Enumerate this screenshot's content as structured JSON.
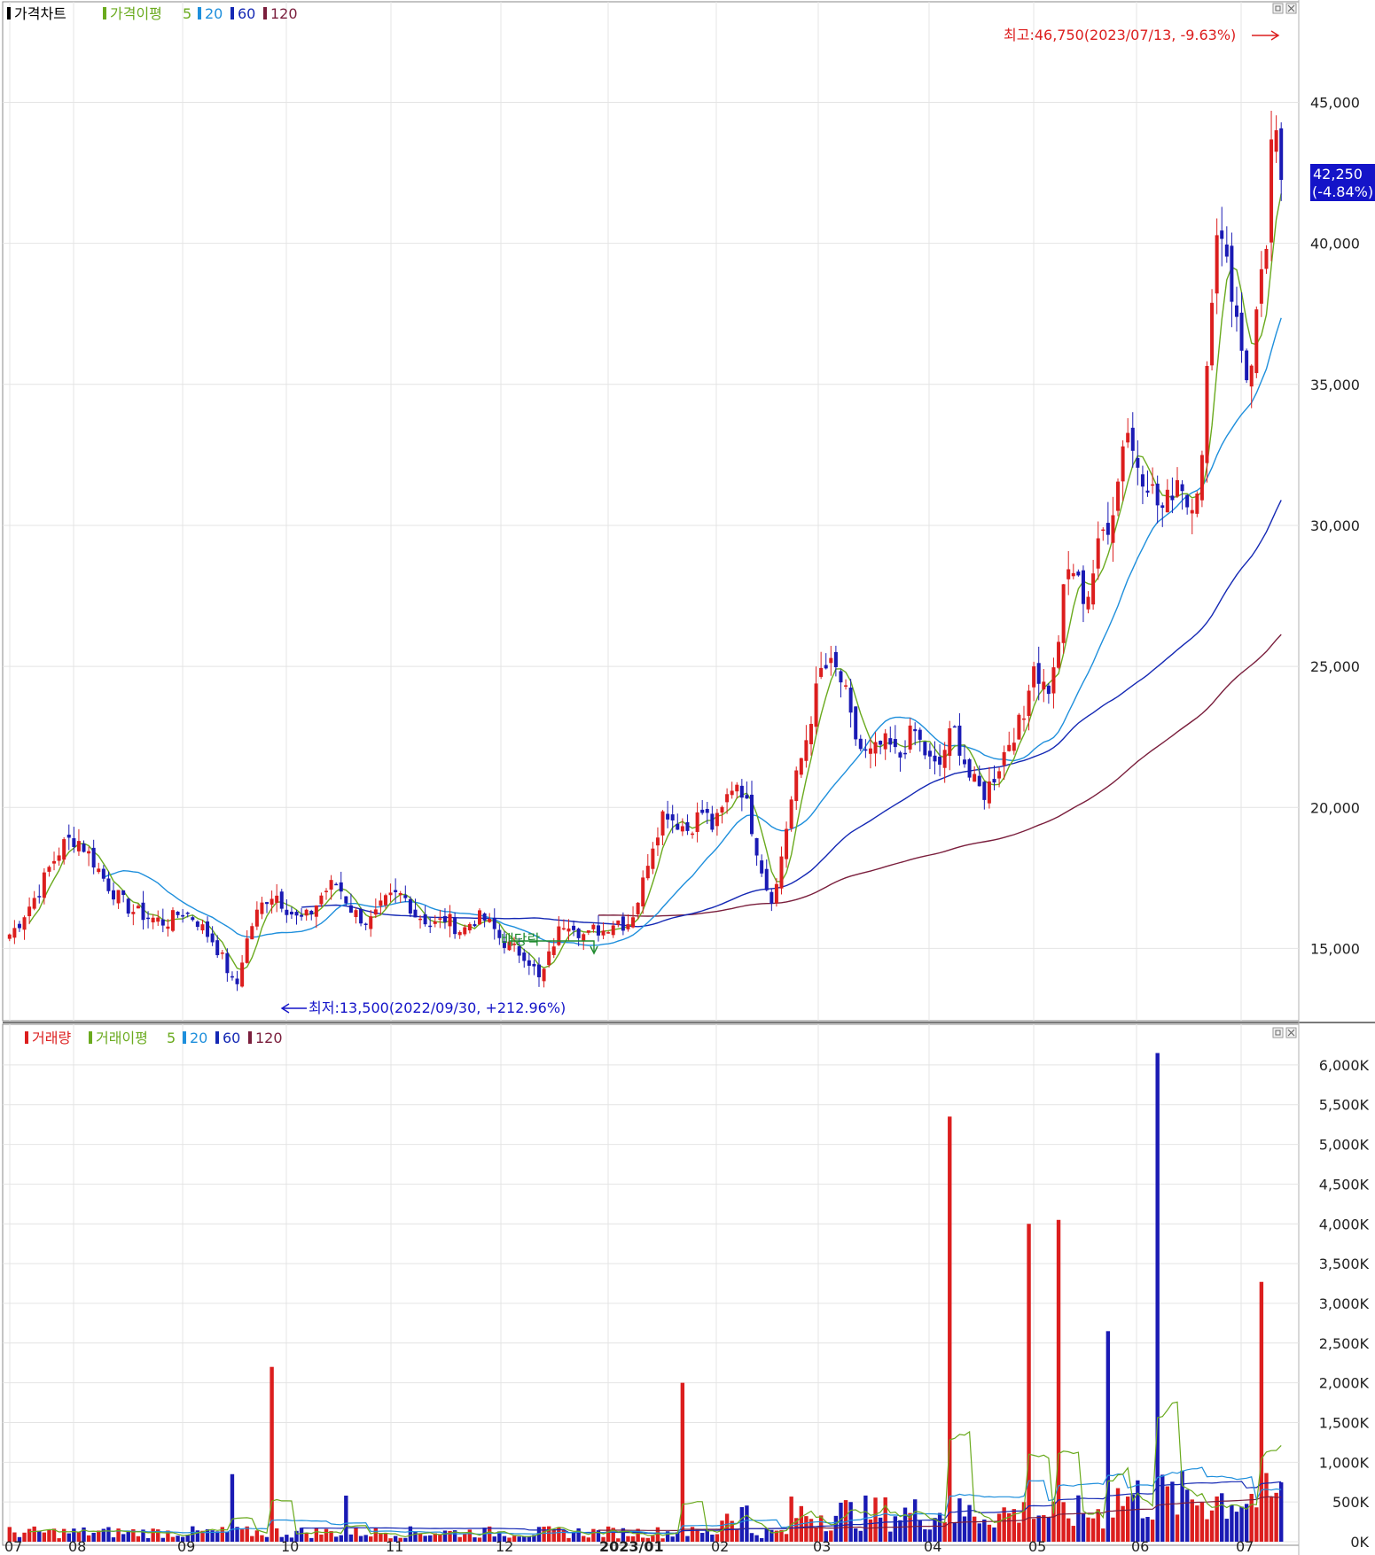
{
  "price_panel": {
    "legend": {
      "title": "가격차트",
      "ma_label": "가격이평",
      "ma_periods": [
        "5",
        "20",
        "60",
        "120"
      ],
      "colors": {
        "title": "#000000",
        "ma5": "#6aaa1e",
        "ma20": "#1e8fdc",
        "ma60": "#1428b4",
        "ma120": "#7a1e3c"
      }
    },
    "y_ticks": [
      "45,000",
      "40,000",
      "35,000",
      "30,000",
      "25,000",
      "20,000",
      "15,000"
    ],
    "current_price": "42,250",
    "current_change": "(-4.84%)",
    "high_annotation": "최고:46,750(2023/07/13, -9.63%)",
    "low_annotation": "최저:13,500(2022/09/30, +212.96%)",
    "event_marker": "배당락"
  },
  "volume_panel": {
    "legend": {
      "title": "거래량",
      "ma_label": "거래이평",
      "ma_periods": [
        "5",
        "20",
        "60",
        "120"
      ],
      "colors": {
        "title": "#dc1e1e",
        "ma5": "#6aaa1e",
        "ma20": "#1e8fdc",
        "ma60": "#1428b4",
        "ma120": "#7a1e3c"
      }
    },
    "y_ticks": [
      "6,000K",
      "5,500K",
      "5,000K",
      "4,500K",
      "4,000K",
      "3,500K",
      "3,000K",
      "2,500K",
      "2,000K",
      "1,500K",
      "1,000K",
      "500K",
      "0K"
    ]
  },
  "x_axis": {
    "labels": [
      "07",
      "08",
      "09",
      "10",
      "11",
      "12",
      "2023/01",
      "02",
      "03",
      "04",
      "05",
      "06",
      "07"
    ]
  },
  "colors": {
    "up": "#dc1e1e",
    "down": "#1a1ab4",
    "grid": "#e4e4e4",
    "highlight_bg": "#1414c8"
  },
  "chart_data": [
    {
      "type": "line",
      "name": "가격차트",
      "x": [
        "07",
        "08",
        "09",
        "10",
        "11",
        "12",
        "2023/01",
        "02",
        "03",
        "04",
        "05",
        "06",
        "07"
      ],
      "ylim": [
        12500,
        48000
      ],
      "key_points": [
        {
          "date": "2022/09/30",
          "value": 13500
        },
        {
          "date": "2023/07/13",
          "value": 46750
        },
        {
          "date": "last",
          "value": 42250
        }
      ],
      "close_series": [
        15500,
        15800,
        16300,
        16700,
        17200,
        17800,
        18300,
        18700,
        18900,
        18800,
        18400,
        18000,
        17500,
        17100,
        16800,
        16500,
        16300,
        16200,
        16100,
        16000,
        15900,
        16100,
        16300,
        16200,
        16000,
        15600,
        15300,
        14800,
        14200,
        13500,
        14900,
        15800,
        16400,
        16800,
        17000,
        16600,
        16300,
        16000,
        16100,
        16400,
        16900,
        17200,
        17300,
        16800,
        16300,
        16100,
        15900,
        16200,
        16600,
        16800,
        16900,
        16700,
        16200,
        16100,
        15800,
        15900,
        16100,
        15800,
        15600,
        15900,
        16100,
        16000,
        15700,
        15300,
        15100,
        14900,
        14800,
        14400,
        13800,
        14600,
        15400,
        15900,
        16000,
        15600,
        15400,
        15700,
        15600,
        15900,
        16000,
        15800,
        16300,
        17100,
        18400,
        19200,
        20000,
        19600,
        19400,
        19200,
        19600,
        19900,
        19300,
        19600,
        20400,
        21000,
        20600,
        19500,
        18300,
        17200,
        16700,
        18400,
        20000,
        21200,
        22300,
        23600,
        24800,
        25000,
        24800,
        24200,
        22800,
        22100,
        21800,
        22000,
        22300,
        22100,
        21700,
        22400,
        22700,
        22100,
        21600,
        21300,
        22200,
        22800,
        22000,
        21100,
        20700,
        20500,
        21000,
        21600,
        22300,
        22800,
        23100,
        25300,
        24600,
        24100,
        24900,
        27400,
        28700,
        27900,
        27300,
        28500,
        29700,
        30200,
        31400,
        33800,
        32600,
        32000,
        31600,
        30800,
        30500,
        31300,
        31900,
        30700,
        31300,
        32400,
        38200,
        40900,
        39800,
        37500,
        36100,
        35000,
        37600,
        39500,
        44300,
        42250
      ],
      "series": [
        {
          "name": "가격이평 5",
          "period": 5
        },
        {
          "name": "가격이평 20",
          "period": 20
        },
        {
          "name": "가격이평 60",
          "period": 60
        },
        {
          "name": "가격이평 120",
          "period": 120
        }
      ]
    },
    {
      "type": "bar",
      "name": "거래량",
      "ylim": [
        0,
        6300
      ],
      "unit": "K",
      "spikes": [
        {
          "x": "2022/09",
          "value": 850
        },
        {
          "x": "2022/09/30",
          "value": 2200
        },
        {
          "x": "2022/10/end",
          "value": 580
        },
        {
          "x": "2023/02",
          "value": 2000
        },
        {
          "x": "2023/04/end",
          "value": 5350
        },
        {
          "x": "2023/05/mid",
          "value": 4000
        },
        {
          "x": "2023/05/end",
          "value": 4050
        },
        {
          "x": "2023/06",
          "value": 2650
        },
        {
          "x": "2023/07",
          "value": 6150
        },
        {
          "x": "2023/07/last",
          "value": 3270
        }
      ]
    }
  ]
}
